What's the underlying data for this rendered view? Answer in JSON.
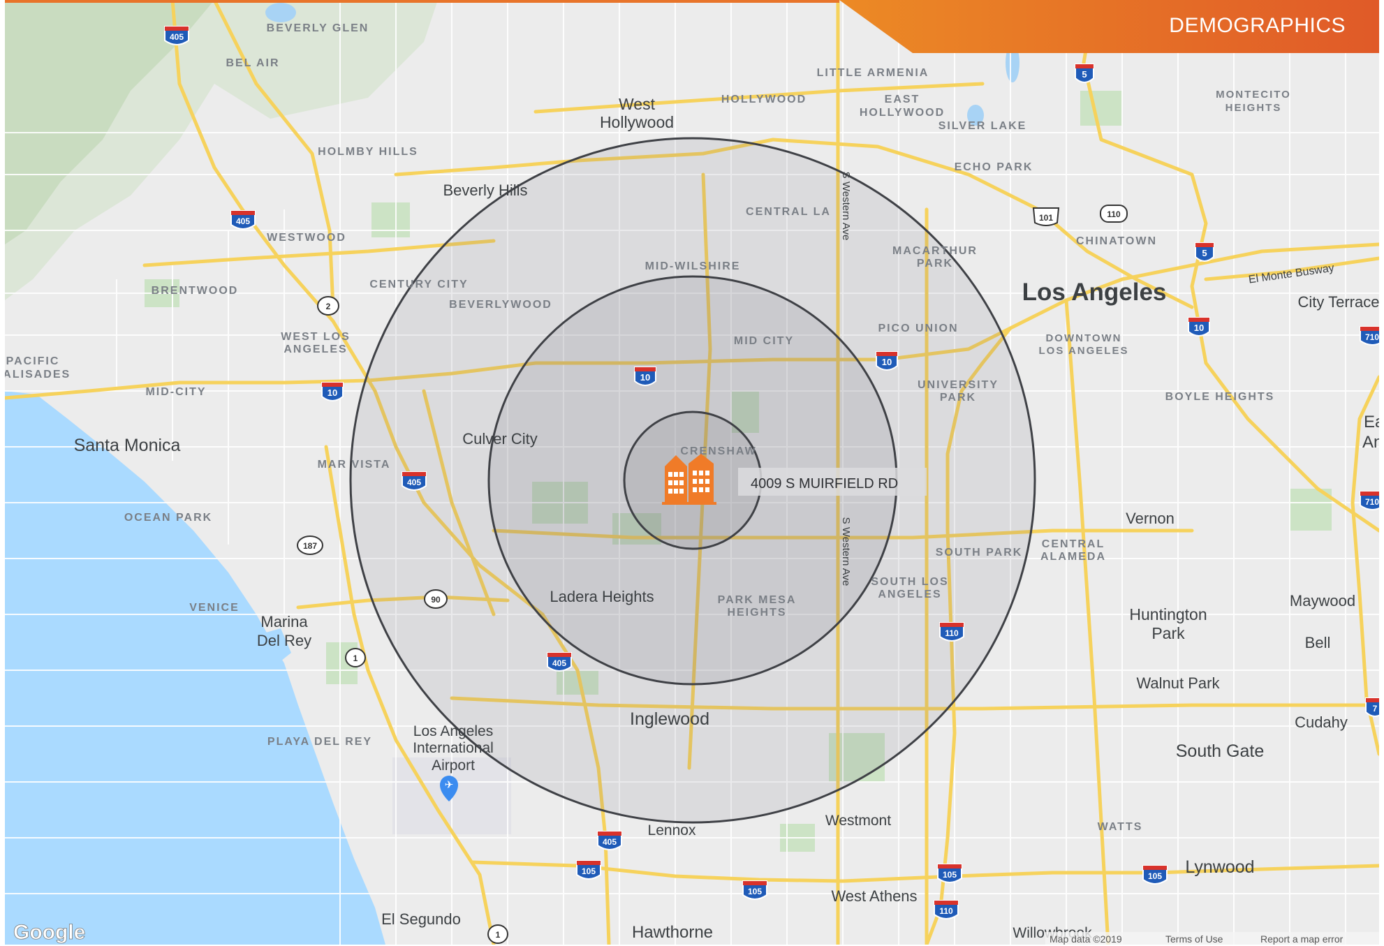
{
  "header": {
    "title": "DEMOGRAPHICS",
    "accent_color": "#e0612a"
  },
  "map": {
    "provider_logo": "Google",
    "footer": {
      "map_data": "Map data ©2019",
      "terms": "Terms of Use",
      "report": "Report a map error"
    },
    "subject": {
      "address": "4009 S MUIRFIELD RD",
      "icon": "building-icon"
    },
    "radius_rings": 3,
    "cities": [
      "West Hollywood",
      "Beverly Hills",
      "Culver City",
      "Santa Monica",
      "Ladera Heights",
      "Marina Del Rey",
      "Inglewood",
      "Los Angeles International Airport",
      "Lennox",
      "Westmont",
      "West Athens",
      "Hawthorne",
      "El Segundo",
      "Los Angeles",
      "City Terrace",
      "Vernon",
      "Huntington Park",
      "Maywood",
      "Bell",
      "Walnut Park",
      "Cudahy",
      "South Gate",
      "Lynwood",
      "Willowbrook"
    ],
    "neighborhoods": [
      "BEVERLY GLEN",
      "BEL AIR",
      "LITTLE ARMENIA",
      "HOLLYWOOD",
      "EAST HOLLYWOOD",
      "SILVER LAKE",
      "MONTECITO HEIGHTS",
      "ECHO PARK",
      "HOLMBY HILLS",
      "WESTWOOD",
      "CENTRAL LA",
      "CHINATOWN",
      "BRENTWOOD",
      "CENTURY CITY",
      "BEVERLYWOOD",
      "MID-WILSHIRE",
      "MACARTHUR PARK",
      "WEST LOS ANGELES",
      "PACIFIC PALISADES",
      "MID-CITY",
      "MID CITY",
      "PICO UNION",
      "DOWNTOWN LOS ANGELES",
      "UNIVERSITY PARK",
      "BOYLE HEIGHTS",
      "MAR VISTA",
      "CRENSHAW",
      "OCEAN PARK",
      "SOUTH PARK",
      "CENTRAL ALAMEDA",
      "SOUTH LOS ANGELES",
      "PARK MESA HEIGHTS",
      "VENICE",
      "PLAYA DEL REY",
      "WATTS"
    ],
    "street_labels": [
      "S Western Ave",
      "El Monte Busway"
    ],
    "edge_fragments": [
      "Eas",
      "An"
    ],
    "route_shields": [
      "405",
      "405",
      "405",
      "405",
      "405",
      "10",
      "10",
      "10",
      "10",
      "5",
      "5",
      "101",
      "110",
      "110",
      "110",
      "105",
      "105",
      "105",
      "105",
      "2",
      "187",
      "90",
      "1",
      "1",
      "710",
      "710",
      "7"
    ]
  }
}
